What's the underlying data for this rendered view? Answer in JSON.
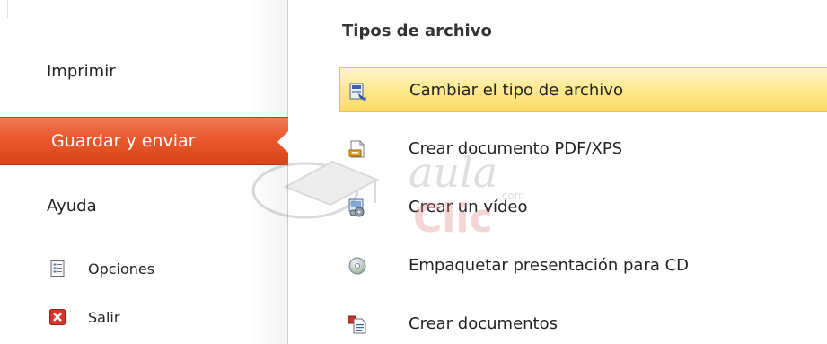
{
  "nav": {
    "print_label": "Imprimir",
    "active_label": "Guardar y enviar",
    "help_label": "Ayuda",
    "options_label": "Opciones",
    "exit_label": "Salir"
  },
  "panel": {
    "section_title": "Tipos de archivo",
    "items": [
      {
        "label": "Cambiar el tipo de archivo",
        "icon": "change-file-type-icon",
        "selected": true
      },
      {
        "label": "Crear documento PDF/XPS",
        "icon": "pdf-document-icon",
        "selected": false
      },
      {
        "label": "Crear un vídeo",
        "icon": "video-icon",
        "selected": false
      },
      {
        "label": "Empaquetar presentación para CD",
        "icon": "cd-icon",
        "selected": false
      },
      {
        "label": "Crear documentos",
        "icon": "create-documents-icon",
        "selected": false
      }
    ]
  },
  "watermark": {
    "word1": "aula",
    "word2": "Clic",
    "suffix": ".com"
  },
  "colors": {
    "active_orange": "#e9582e",
    "selected_yellow": "#fde78a",
    "exit_red": "#d9342b"
  }
}
